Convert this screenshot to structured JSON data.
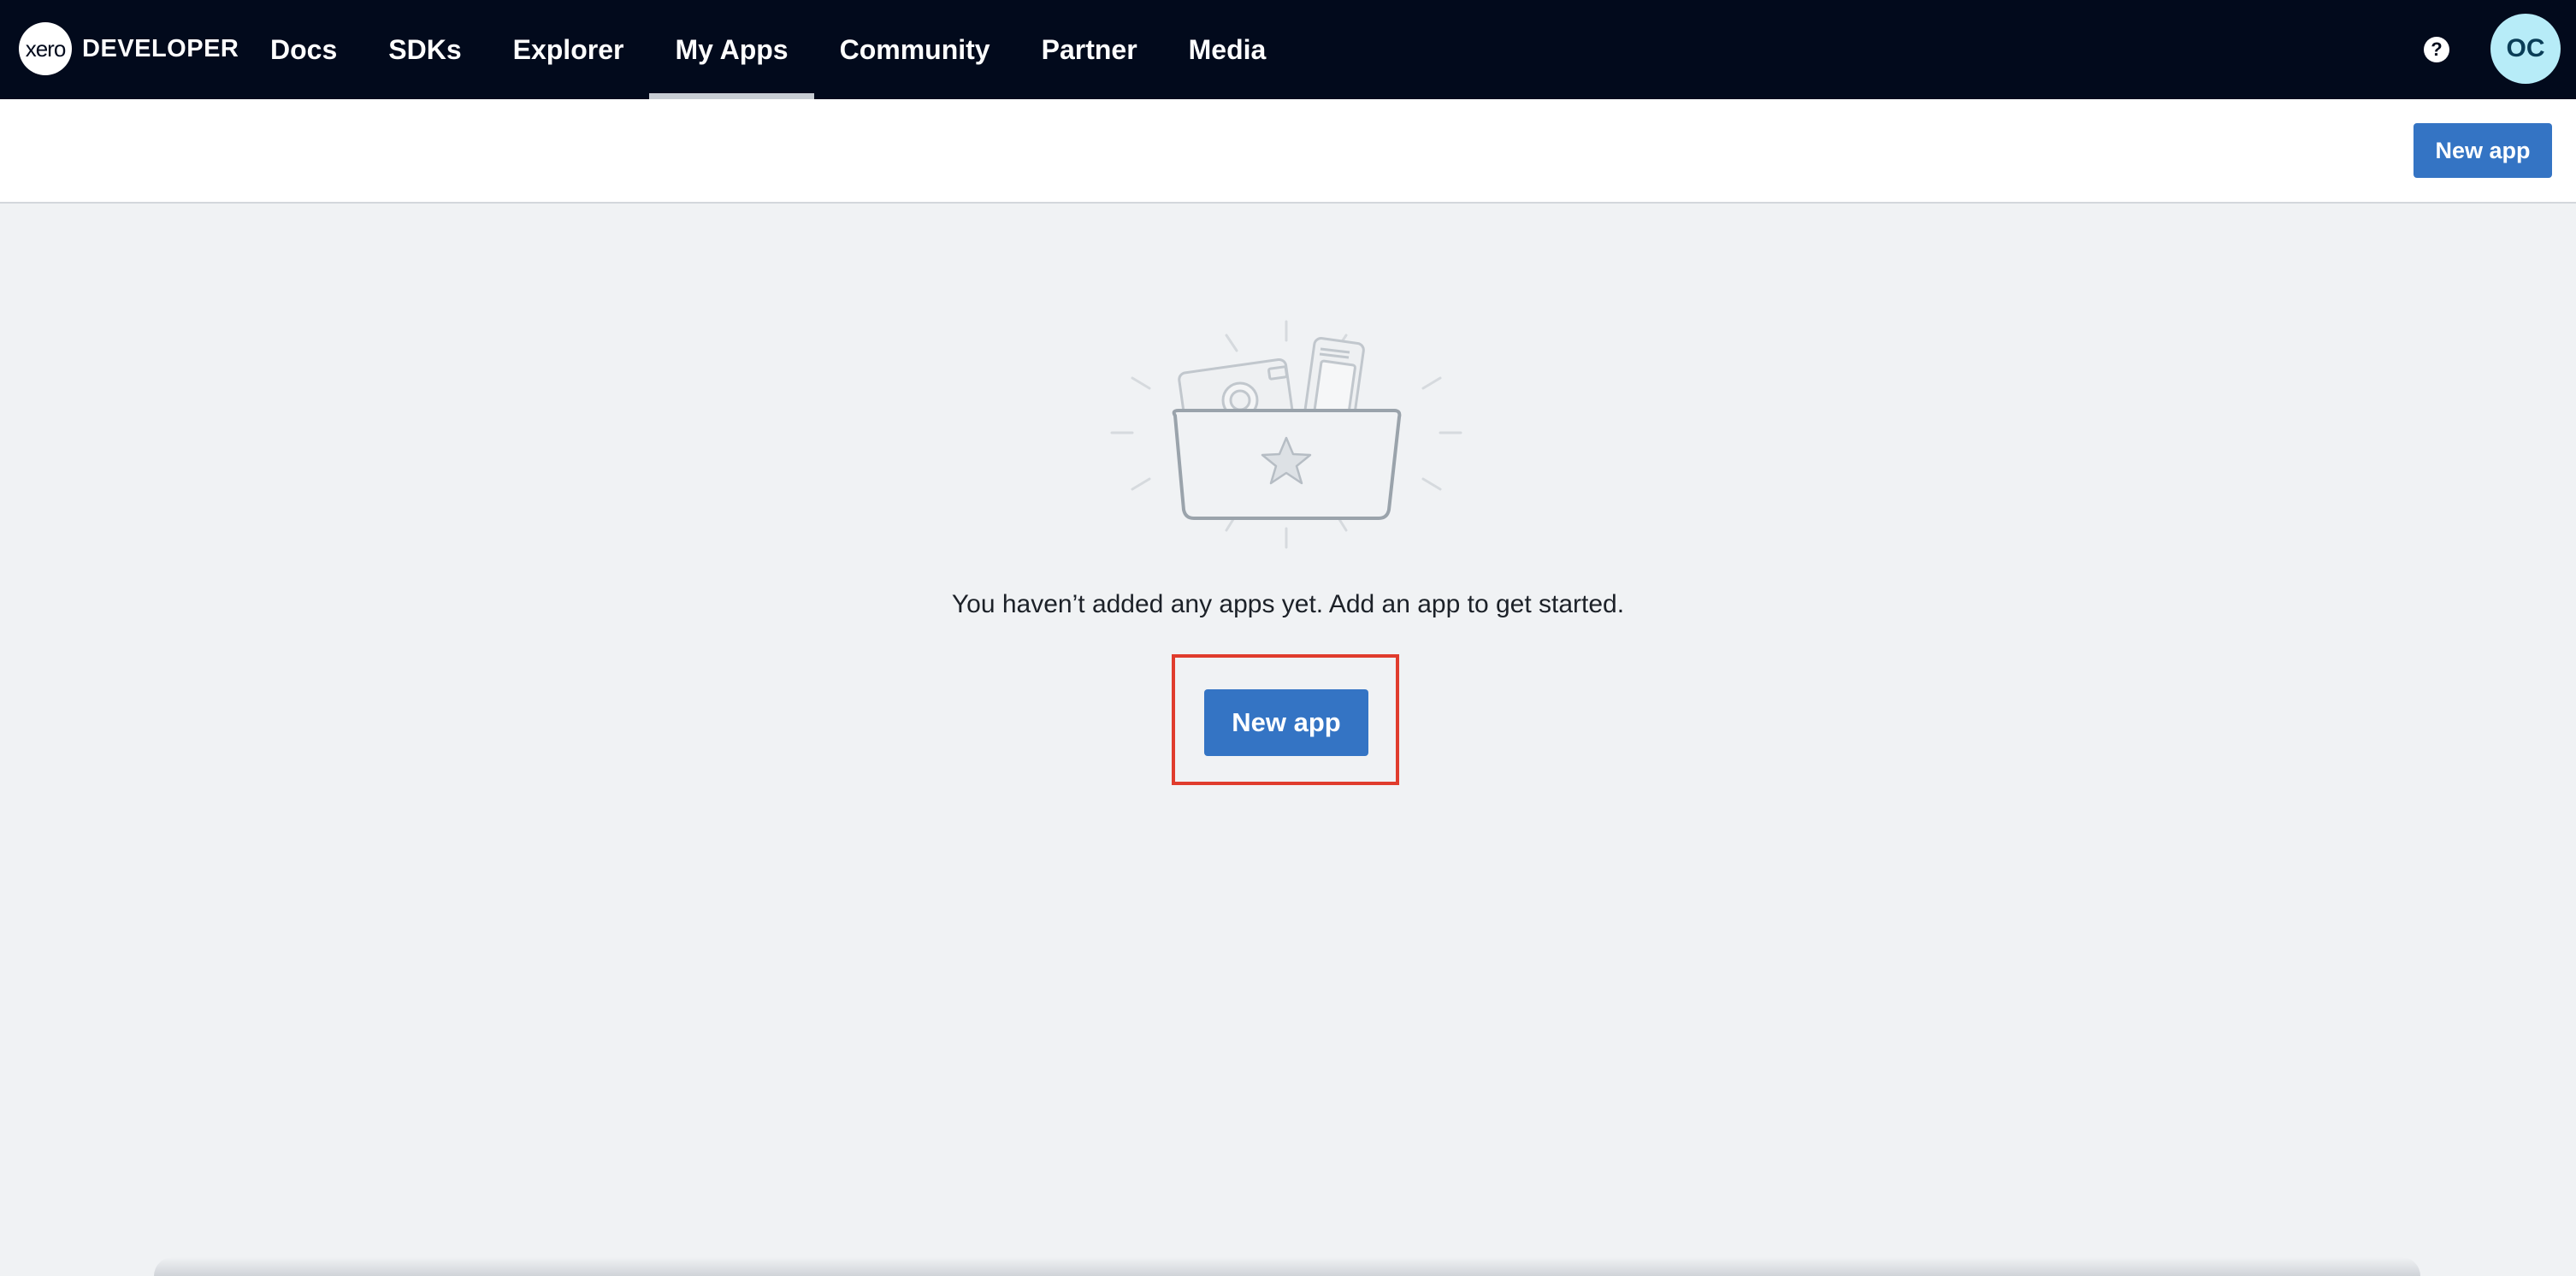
{
  "brand": {
    "logo_text": "xero",
    "product": "DEVELOPER"
  },
  "nav": {
    "items": [
      {
        "label": "Docs"
      },
      {
        "label": "SDKs"
      },
      {
        "label": "Explorer"
      },
      {
        "label": "My Apps",
        "active": true
      },
      {
        "label": "Community"
      },
      {
        "label": "Partner"
      },
      {
        "label": "Media"
      }
    ],
    "help_symbol": "?",
    "avatar_initials": "OC"
  },
  "subheader": {
    "new_app_label": "New app"
  },
  "empty_state": {
    "illustration": "folder-with-apps-illustration",
    "message": "You haven’t added any apps yet. Add an app to get started.",
    "new_app_label": "New app"
  },
  "colors": {
    "nav_bg": "#020a1c",
    "primary_button": "#3474c4",
    "page_bg": "#f0f2f4",
    "avatar_bg": "#b7ecf8",
    "highlight": "#e03c2d"
  }
}
